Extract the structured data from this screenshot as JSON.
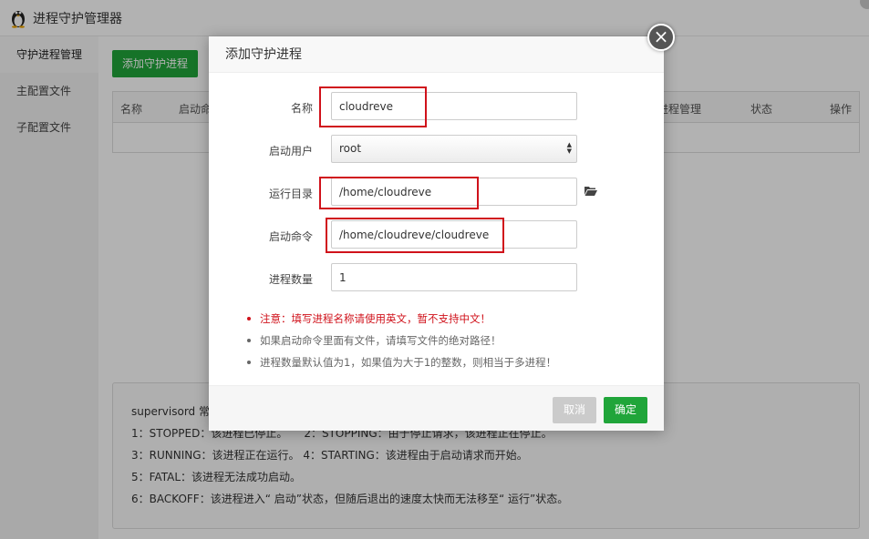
{
  "app": {
    "title": "进程守护管理器"
  },
  "sidebar": {
    "items": [
      {
        "label": "守护进程管理"
      },
      {
        "label": "主配置文件"
      },
      {
        "label": "子配置文件"
      }
    ]
  },
  "main": {
    "add_button": "添加守护进程",
    "table_headers": {
      "name": "名称",
      "start": "启动命",
      "process_mgmt": "进程管理",
      "status": "状态",
      "action": "操作"
    },
    "info_lines": [
      "supervisord 常见状态说明：",
      "1：STOPPED：该进程已停止。　　2：STOPPING：由于停止请求，该进程正在停止。",
      "3：RUNNING：该进程正在运行。 4：STARTING：该进程由于启动请求而开始。",
      "5：FATAL：该进程无法成功启动。",
      "6：BACKOFF：该进程进入“ 启动”状态，但随后退出的速度太快而无法移至“ 运行”状态。"
    ]
  },
  "modal": {
    "title": "添加守护进程",
    "fields": {
      "name": {
        "label": "名称",
        "value": "cloudreve"
      },
      "user": {
        "label": "启动用户",
        "value": "root"
      },
      "dir": {
        "label": "运行目录",
        "value": "/home/cloudreve"
      },
      "cmd": {
        "label": "启动命令",
        "value": "/home/cloudreve/cloudreve"
      },
      "count": {
        "label": "进程数量",
        "value": "1"
      }
    },
    "notes": [
      "注意：填写进程名称请使用英文，暂不支持中文！",
      "如果启动命令里面有文件，请填写文件的绝对路径！",
      "进程数量默认值为1，如果值为大于1的整数，则相当于多进程！"
    ],
    "cancel_label": "取消",
    "ok_label": "确定"
  },
  "colors": {
    "accent": "#20a53a",
    "highlight": "#d0121b",
    "warning": "#d0121b"
  },
  "icons": [
    "linux-penguin-icon",
    "close-icon",
    "folder-open-icon",
    "select-arrows-icon"
  ]
}
